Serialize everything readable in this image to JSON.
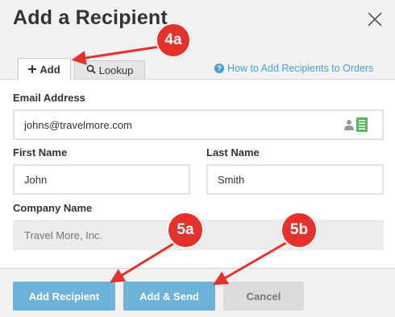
{
  "dialog": {
    "title": "Add a Recipient"
  },
  "tabs": [
    {
      "label": "Add",
      "icon": "plus-icon",
      "active": true
    },
    {
      "label": "Lookup",
      "icon": "search-icon",
      "active": false
    }
  ],
  "help_link": {
    "label": "How to Add Recipients to Orders",
    "icon": "question-circle-icon"
  },
  "form": {
    "email": {
      "label": "Email Address",
      "value": "johns@travelmore.com"
    },
    "first_name": {
      "label": "First Name",
      "value": "John"
    },
    "last_name": {
      "label": "Last Name",
      "value": "Smith"
    },
    "company": {
      "label": "Company Name",
      "placeholder": "Travel More, Inc."
    }
  },
  "buttons": {
    "add_recipient": "Add Recipient",
    "add_send": "Add & Send",
    "cancel": "Cancel"
  },
  "callouts": {
    "add_tab": "4a",
    "add_recipient": "5a",
    "add_send": "5b"
  },
  "colors": {
    "primary_button": "#6cb2d9",
    "link": "#4a9ed6",
    "callout": "#e5312b",
    "contact_book": "#5cb85c"
  }
}
